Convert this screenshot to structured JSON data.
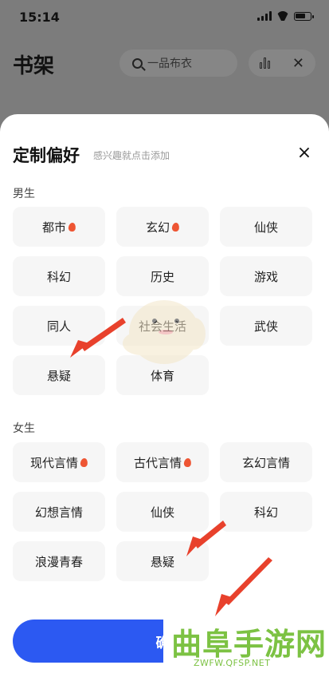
{
  "status": {
    "time": "15:14"
  },
  "background_page": {
    "title": "书架",
    "search_placeholder": "一品布衣"
  },
  "sheet": {
    "title": "定制偏好",
    "subtitle": "感兴趣就点击添加",
    "close_label": "×",
    "male": {
      "label": "男生",
      "items": [
        {
          "label": "都市",
          "hot": true
        },
        {
          "label": "玄幻",
          "hot": true
        },
        {
          "label": "仙侠",
          "hot": false
        },
        {
          "label": "科幻",
          "hot": false
        },
        {
          "label": "历史",
          "hot": false
        },
        {
          "label": "游戏",
          "hot": false
        },
        {
          "label": "同人",
          "hot": false
        },
        {
          "label": "社会生活",
          "hot": false
        },
        {
          "label": "武侠",
          "hot": false
        },
        {
          "label": "悬疑",
          "hot": false
        },
        {
          "label": "体育",
          "hot": false
        }
      ]
    },
    "female": {
      "label": "女生",
      "items": [
        {
          "label": "现代言情",
          "hot": true
        },
        {
          "label": "古代言情",
          "hot": true
        },
        {
          "label": "玄幻言情",
          "hot": false
        },
        {
          "label": "幻想言情",
          "hot": false
        },
        {
          "label": "仙侠",
          "hot": false
        },
        {
          "label": "科幻",
          "hot": false
        },
        {
          "label": "浪漫青春",
          "hot": false
        },
        {
          "label": "悬疑",
          "hot": false
        }
      ]
    },
    "confirm_label": "确"
  },
  "watermark": {
    "main": "曲阜手游网",
    "sub": "ZWFW.QFSP.NET"
  },
  "colors": {
    "accent": "#2c59f2",
    "arrow": "#e8412c",
    "hot": "#ee5533",
    "watermark": "#7cc243"
  }
}
